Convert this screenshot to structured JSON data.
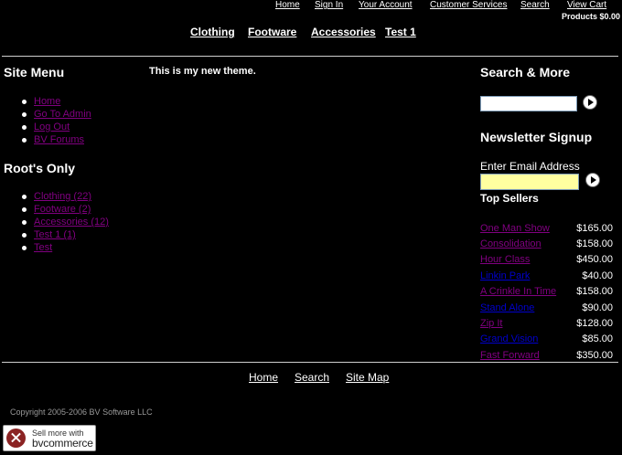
{
  "top_nav": [
    {
      "label": "Home"
    },
    {
      "label": "Sign In"
    },
    {
      "label": "Your Account"
    },
    {
      "label": "Customer Services"
    },
    {
      "label": "Search"
    },
    {
      "label": "View Cart"
    }
  ],
  "cart_summary": "Products $0.00",
  "category_nav": [
    {
      "label": "Clothing"
    },
    {
      "label": "Footware"
    },
    {
      "label": "Accessories"
    },
    {
      "label": "Test 1"
    }
  ],
  "site_menu": {
    "title": "Site Menu",
    "items": [
      {
        "label": "Home"
      },
      {
        "label": "Go To Admin"
      },
      {
        "label": "Log Out"
      },
      {
        "label": "BV Forums"
      }
    ]
  },
  "roots_only": {
    "title": "Root's Only",
    "items": [
      {
        "label": "Clothing (22)"
      },
      {
        "label": "Footware (2)"
      },
      {
        "label": "Accessories (12)"
      },
      {
        "label": "Test 1 (1)"
      },
      {
        "label": "Test"
      }
    ]
  },
  "main": {
    "message": "This is my new theme."
  },
  "search": {
    "title": "Search & More",
    "value": ""
  },
  "newsletter": {
    "title": "Newsletter Signup",
    "email_label": "Enter Email Address",
    "value": ""
  },
  "top_sellers": {
    "title": "Top Sellers",
    "items": [
      {
        "name": "One Man Show",
        "price": "$165.00",
        "color": "#800080"
      },
      {
        "name": "Consolidation",
        "price": "$158.00",
        "color": "#800080"
      },
      {
        "name": "Hour Class",
        "price": "$450.00",
        "color": "#800080"
      },
      {
        "name": "Linkin Park",
        "price": "$40.00",
        "color": "#0000cc"
      },
      {
        "name": "A Crinkle In Time",
        "price": "$158.00",
        "color": "#800080"
      },
      {
        "name": "Stand Alone",
        "price": "$90.00",
        "color": "#0000cc"
      },
      {
        "name": "Zip It",
        "price": "$128.00",
        "color": "#800080"
      },
      {
        "name": "Grand Vision",
        "price": "$85.00",
        "color": "#0000cc"
      },
      {
        "name": "Fast Forward",
        "price": "$350.00",
        "color": "#800080"
      }
    ]
  },
  "footer_nav": [
    {
      "label": "Home"
    },
    {
      "label": "Search"
    },
    {
      "label": "Site Map"
    }
  ],
  "copyright": "Copyright 2005-2006 BV Software LLC",
  "badge": {
    "line1": "Sell more with",
    "line2": "bvcommerce"
  },
  "colors": {
    "background": "#000000",
    "text": "#ffffff",
    "visited_link": "#800080",
    "link": "#0000cc",
    "email_field": "#ffffa0"
  }
}
